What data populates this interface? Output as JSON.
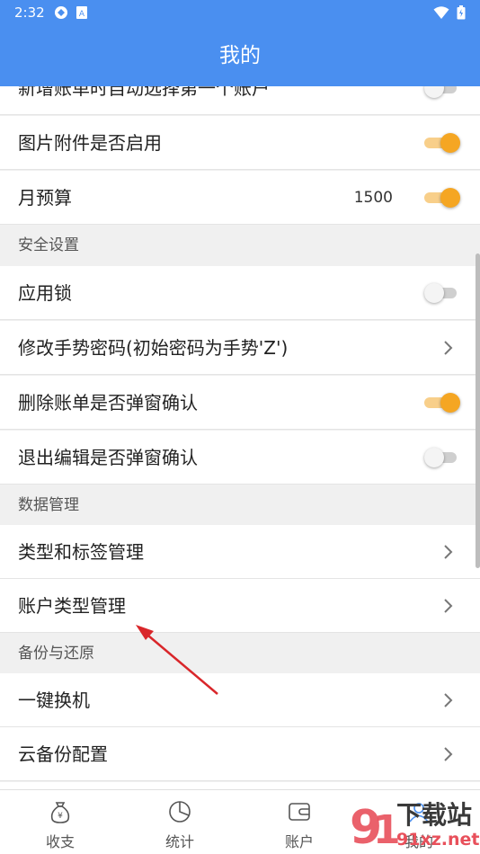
{
  "status_bar": {
    "time": "2:32"
  },
  "app_bar": {
    "title": "我的"
  },
  "rows": {
    "auto_select_account": {
      "label": "新增账单时自动选择第一个账户",
      "switch": "off"
    },
    "image_attachment": {
      "label": "图片附件是否启用",
      "switch": "on"
    },
    "monthly_budget": {
      "label": "月预算",
      "value": "1500",
      "switch": "on"
    },
    "app_lock": {
      "label": "应用锁",
      "switch": "off"
    },
    "change_gesture": {
      "label": "修改手势密码(初始密码为手势'Z')"
    },
    "delete_confirm": {
      "label": "删除账单是否弹窗确认",
      "switch": "on"
    },
    "exit_edit_confirm": {
      "label": "退出编辑是否弹窗确认",
      "switch": "off"
    },
    "type_tag_manage": {
      "label": "类型和标签管理"
    },
    "account_type_manage": {
      "label": "账户类型管理"
    },
    "one_key_switch": {
      "label": "一键换机"
    },
    "cloud_backup": {
      "label": "云备份配置"
    }
  },
  "sections": {
    "security": "安全设置",
    "data": "数据管理",
    "backup": "备份与还原"
  },
  "bottom_nav": {
    "items": [
      {
        "label": "收支",
        "icon": "money-bag-icon"
      },
      {
        "label": "统计",
        "icon": "pie-chart-icon"
      },
      {
        "label": "账户",
        "icon": "wallet-icon"
      },
      {
        "label": "我的",
        "icon": "user-icon"
      }
    ]
  },
  "watermark": {
    "brand": "下载站",
    "domain": "91xz.net"
  },
  "colors": {
    "primary": "#4a8ff0",
    "switch_on": "#f5a623",
    "annotation_arrow": "#d9262a"
  }
}
